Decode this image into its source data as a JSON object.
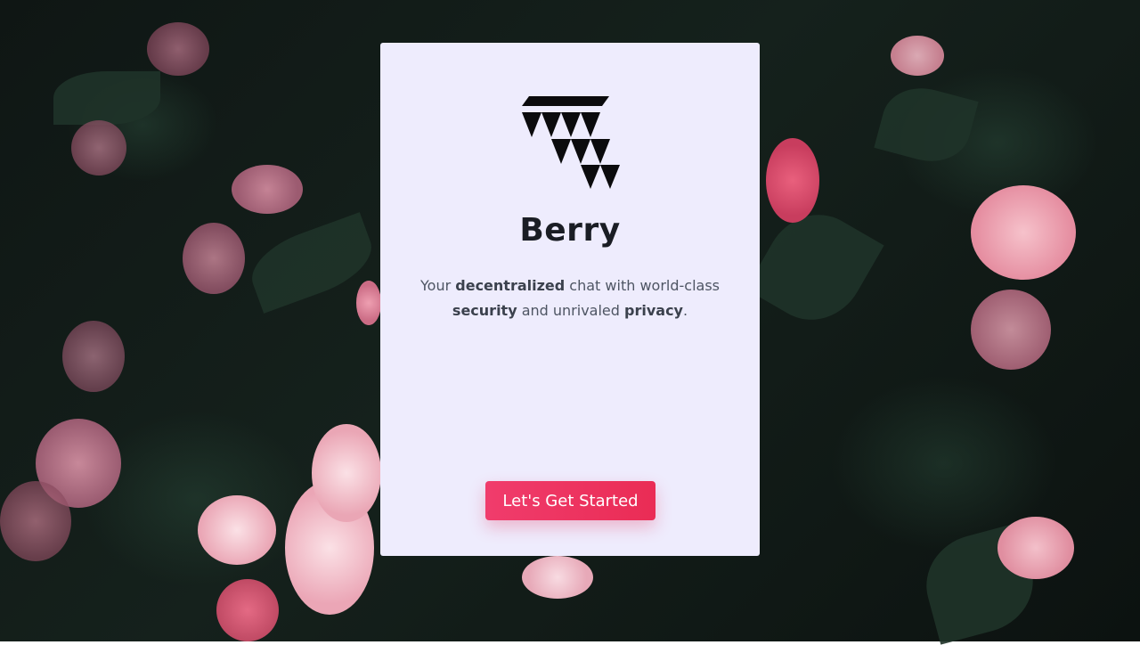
{
  "app": {
    "name": "Berry",
    "logo_icon": "berry-logo-icon"
  },
  "tagline": {
    "part1": "Your ",
    "bold1": "decentralized",
    "part2": " chat with world-class ",
    "bold2": "security",
    "part3": " and unrivaled ",
    "bold3": "privacy",
    "part4": "."
  },
  "cta": {
    "label": "Let's Get Started"
  },
  "colors": {
    "card_background": "#eeecfd",
    "accent": "#f03c6c",
    "title": "#1a1d24",
    "text": "#4e5563"
  }
}
